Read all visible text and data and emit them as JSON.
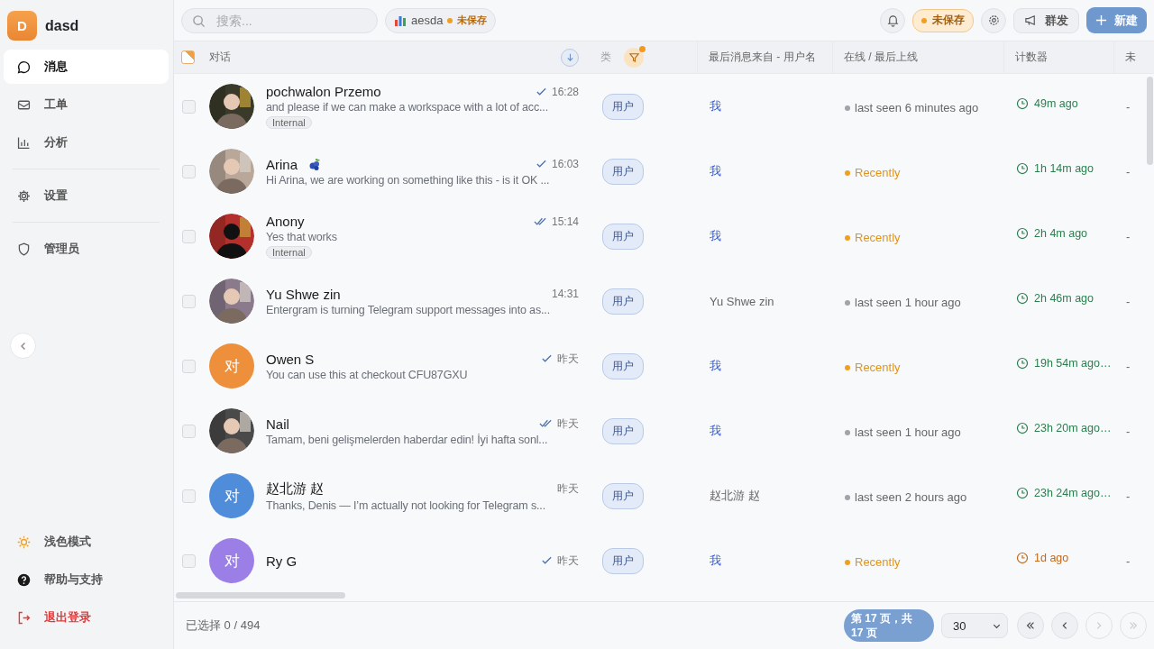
{
  "sidebar": {
    "brand": {
      "initial": "D",
      "name": "dasd"
    },
    "sections": [
      [
        {
          "label": "消息",
          "kind": "chat",
          "selected": true
        },
        {
          "label": "工单",
          "kind": "ticket",
          "selected": false
        },
        {
          "label": "分析",
          "kind": "chart",
          "selected": false
        }
      ],
      [
        {
          "label": "设置",
          "kind": "gear",
          "selected": false
        }
      ],
      [
        {
          "label": "管理员",
          "kind": "shield",
          "selected": false
        }
      ]
    ],
    "bottom_items": [
      {
        "label": "浅色模式",
        "kind": "theme"
      },
      {
        "label": "帮助与支持",
        "kind": "help"
      },
      {
        "label": "退出登录",
        "kind": "logout"
      }
    ]
  },
  "topbar": {
    "search": {
      "placeholder": "搜索..."
    },
    "view": {
      "name": "aesda",
      "status": "未保存"
    },
    "unsaved": "未保存",
    "broadcast": "群发",
    "new": "新建"
  },
  "header": {
    "select_all": {
      "partial": true
    },
    "conversation": "对话",
    "type": "类",
    "from": "最后消息来自 - 用户名",
    "status": "在线 / 最后上线",
    "counter": "计数器",
    "unread": "未"
  },
  "rows": [
    {
      "checked": false,
      "name": "pochwalon Przemo",
      "delivered": true,
      "read": false,
      "time": "16:28",
      "preview": "and please if we can make a workspace with a lot of acc...",
      "tag": "Internal",
      "type": "用户",
      "from": {
        "text": "我",
        "kind": "me"
      },
      "presence": {
        "text": "last seen 6 minutes ago",
        "kind": "offline"
      },
      "counter": {
        "text": "49m ago",
        "color": "#2e7d4f"
      },
      "unread": "-"
    },
    {
      "checked": false,
      "name": "Arina",
      "emoji": true,
      "delivered": true,
      "read": false,
      "time": "16:03",
      "preview": "Hi Arina, we are working on something like this - is it OK ...",
      "type": "用户",
      "from": {
        "text": "我",
        "kind": "me"
      },
      "presence": {
        "text": "Recently",
        "kind": "recent"
      },
      "counter": {
        "text": "1h 14m ago",
        "color": "#2e7d4f"
      },
      "unread": "-"
    },
    {
      "checked": false,
      "name": "Anony",
      "delivered": true,
      "read": true,
      "time": "15:14",
      "preview": "Yes that works",
      "tag": "Internal",
      "type": "用户",
      "from": {
        "text": "我",
        "kind": "me"
      },
      "presence": {
        "text": "Recently",
        "kind": "recent"
      },
      "counter": {
        "text": "2h 4m ago",
        "color": "#2e7d4f"
      },
      "unread": "-"
    },
    {
      "checked": false,
      "name": "Yu Shwe zin",
      "delivered": false,
      "read": false,
      "time": "14:31",
      "preview": "Entergram is turning Telegram support messages into as...",
      "type": "用户",
      "from": {
        "text": "Yu Shwe zin",
        "kind": "user"
      },
      "presence": {
        "text": "last seen 1 hour ago",
        "kind": "offline"
      },
      "counter": {
        "text": "2h 46m ago",
        "color": "#2e7d4f"
      },
      "unread": "-"
    },
    {
      "checked": false,
      "avatar": {
        "kind": "letter",
        "text": "对",
        "color": "#ee8f3c"
      },
      "name": "Owen S",
      "delivered": true,
      "read": false,
      "time": "昨天",
      "preview": "You can use this at checkout CFU87GXU",
      "type": "用户",
      "from": {
        "text": "我",
        "kind": "me"
      },
      "presence": {
        "text": "Recently",
        "kind": "recent"
      },
      "counter": {
        "text": "19h 54m ago…",
        "color": "#2e7d4f"
      },
      "unread": "-"
    },
    {
      "checked": false,
      "name": "Nail",
      "delivered": true,
      "read": true,
      "time": "昨天",
      "preview": "Tamam, beni gelişmelerden haberdar edin! İyi hafta sonl...",
      "type": "用户",
      "from": {
        "text": "我",
        "kind": "me"
      },
      "presence": {
        "text": "last seen 1 hour ago",
        "kind": "offline"
      },
      "counter": {
        "text": "23h 20m ago…",
        "color": "#2e7d4f"
      },
      "unread": "-"
    },
    {
      "checked": false,
      "avatar": {
        "kind": "letter",
        "text": "对",
        "color": "#4f8ddb"
      },
      "name": "赵北游 赵",
      "delivered": false,
      "read": false,
      "time": "昨天",
      "preview": "Thanks, Denis — I’m actually not looking for Telegram s...",
      "type": "用户",
      "from": {
        "text": "赵北游 赵",
        "kind": "user"
      },
      "presence": {
        "text": "last seen 2 hours ago",
        "kind": "offline"
      },
      "counter": {
        "text": "23h 24m ago…",
        "color": "#2e7d4f"
      },
      "unread": "-"
    },
    {
      "checked": false,
      "avatar": {
        "kind": "letter",
        "text": "对",
        "color": "#9b7fe6"
      },
      "name": "Ry G",
      "delivered": true,
      "read": false,
      "time": "昨天",
      "type": "用户",
      "from": {
        "text": "我",
        "kind": "me"
      },
      "presence": {
        "text": "Recently",
        "kind": "recent"
      },
      "counter": {
        "text": "1d ago",
        "color": "#c2691c"
      },
      "unread": "-"
    }
  ],
  "footer": {
    "selection": "已选择 0 / 494",
    "page": "第 17 页，共 17 页",
    "page_size": "30",
    "nav": [
      {
        "kind": "first",
        "disabled": false
      },
      {
        "kind": "prev",
        "disabled": false
      },
      {
        "kind": "next",
        "disabled": true
      },
      {
        "kind": "last",
        "disabled": true
      }
    ]
  }
}
